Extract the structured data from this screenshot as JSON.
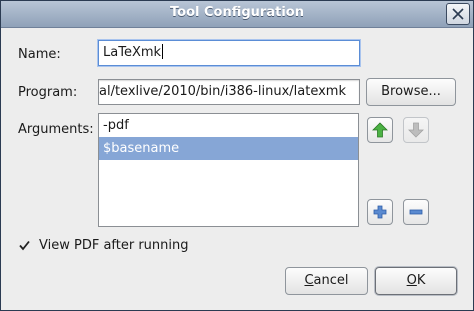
{
  "window": {
    "title": "Tool Configuration"
  },
  "form": {
    "name_label": "Name:",
    "name_value": "LaTeXmk",
    "program_label": "Program:",
    "program_value": "al/texlive/2010/bin/i386-linux/latexmk",
    "browse_label": "Browse...",
    "arguments_label": "Arguments:",
    "arguments": [
      "-pdf",
      "$basename"
    ],
    "selected_argument_index": 1,
    "view_pdf_label": "View PDF after running",
    "view_pdf_checked": true
  },
  "buttons": {
    "cancel_label": "Cancel",
    "ok_label": "OK"
  },
  "icons": {
    "move_up": "arrow-up-icon",
    "move_down": "arrow-down-icon",
    "add": "plus-icon",
    "remove": "minus-icon",
    "close": "close-icon",
    "check": "checkmark-icon"
  },
  "colors": {
    "selection": "#86a6d6",
    "titlebar": "#9aabc1",
    "up_arrow": "#3fa23a",
    "add_remove": "#4a78c0"
  }
}
